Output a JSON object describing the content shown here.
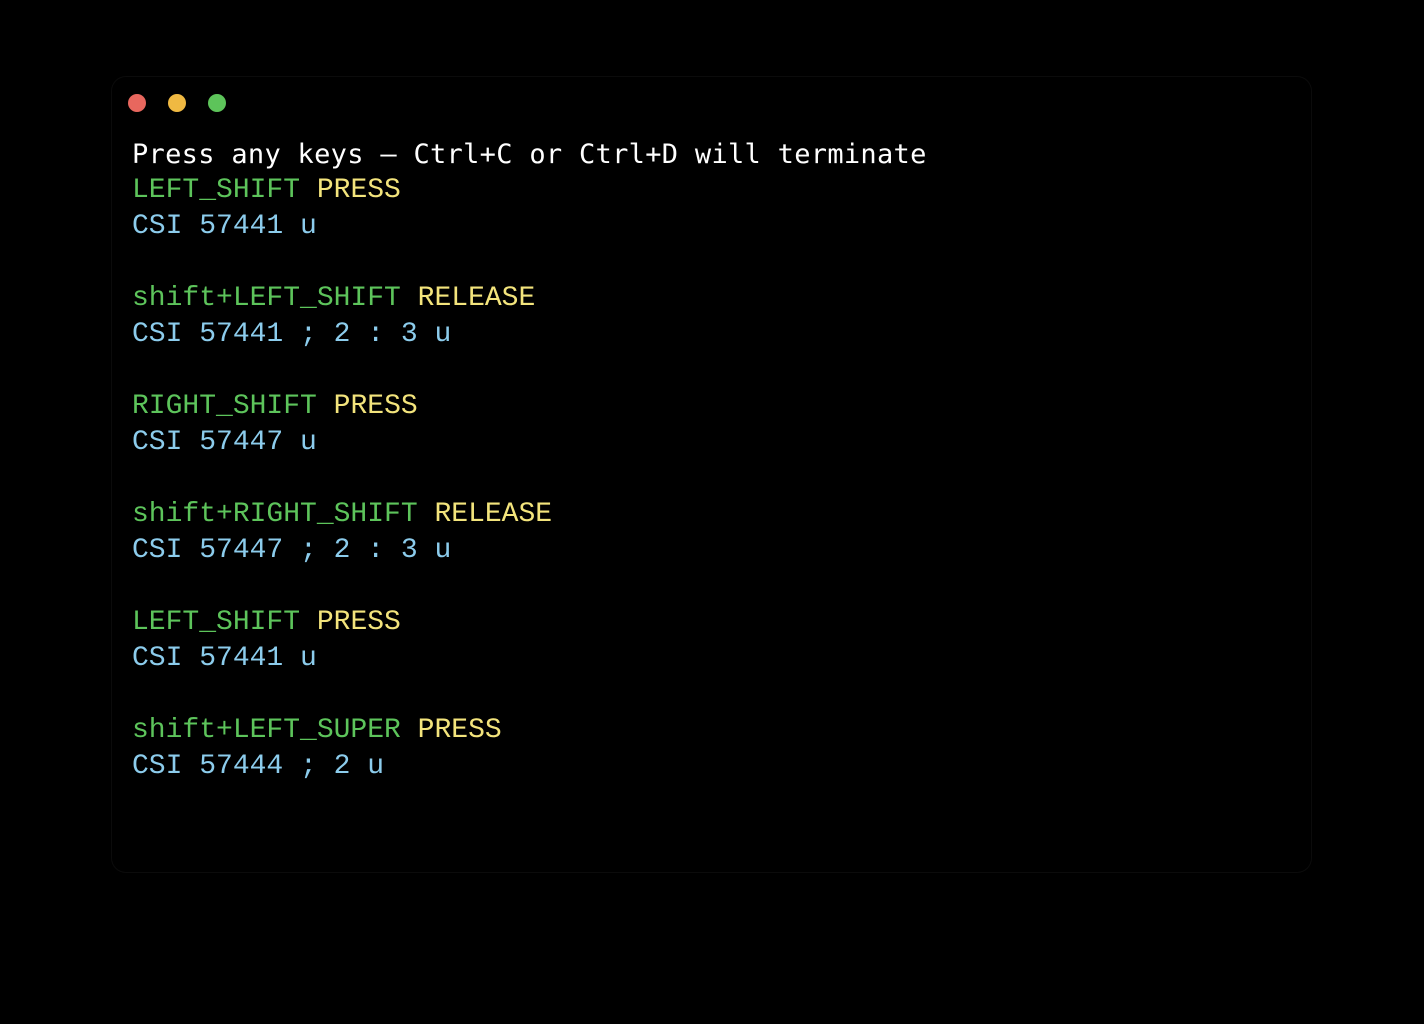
{
  "window": {
    "name": "terminal-window",
    "traffic_lights": [
      {
        "name": "close-button",
        "color": "#E8675E"
      },
      {
        "name": "minimize-button",
        "color": "#F0B942"
      },
      {
        "name": "maximize-button",
        "color": "#5DC45A"
      }
    ]
  },
  "colors": {
    "background": "#000000",
    "header_text": "#FFFFFF",
    "key_green": "#5DC45B",
    "action_yellow": "#F3E47C",
    "csi_blue": "#8CCCEC"
  },
  "terminal": {
    "header_line": "Press any keys – Ctrl+C or Ctrl+D will terminate",
    "events": [
      {
        "key": "LEFT_SHIFT",
        "action": "PRESS",
        "csi": "CSI 57441 u"
      },
      {
        "key": "shift+LEFT_SHIFT",
        "action": "RELEASE",
        "csi": "CSI 57441 ; 2 : 3 u"
      },
      {
        "key": "RIGHT_SHIFT",
        "action": "PRESS",
        "csi": "CSI 57447 u"
      },
      {
        "key": "shift+RIGHT_SHIFT",
        "action": "RELEASE",
        "csi": "CSI 57447 ; 2 : 3 u"
      },
      {
        "key": "LEFT_SHIFT",
        "action": "PRESS",
        "csi": "CSI 57441 u"
      },
      {
        "key": "shift+LEFT_SUPER",
        "action": "PRESS",
        "csi": "CSI 57444 ; 2 u"
      }
    ]
  }
}
